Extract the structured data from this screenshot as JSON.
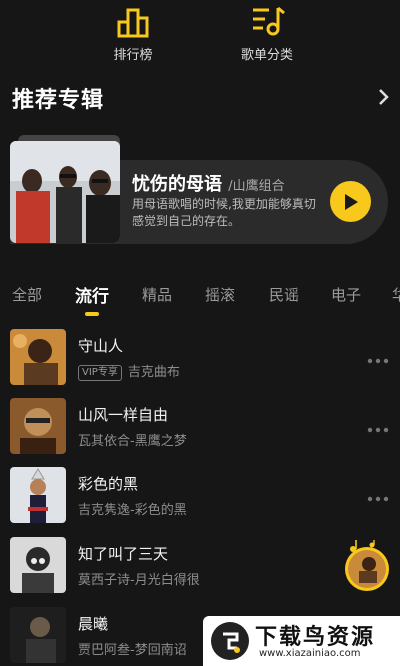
{
  "top_nav": {
    "items": [
      {
        "label": "排行榜",
        "icon": "ranking-icon"
      },
      {
        "label": "歌单分类",
        "icon": "playlist-category-icon"
      }
    ]
  },
  "recommended": {
    "title": "推荐专辑",
    "album": {
      "name": "忧伤的母语",
      "artist": "/山鹰组合",
      "description": "用母语歌唱的时候,我更加能够真切感觉到自己的存在。"
    }
  },
  "tabs": [
    "全部",
    "流行",
    "精品",
    "摇滚",
    "民谣",
    "电子",
    "华"
  ],
  "active_tab": "流行",
  "songs": [
    {
      "title": "守山人",
      "badge": "VIP专享",
      "subtitle": "吉克曲布"
    },
    {
      "title": "山风一样自由",
      "subtitle": "瓦其依合-黑鹰之梦"
    },
    {
      "title": "彩色的黑",
      "subtitle": "吉克隽逸-彩色的黑"
    },
    {
      "title": "知了叫了三天",
      "subtitle": "莫西子诗-月光白得很"
    },
    {
      "title": "晨曦",
      "subtitle": "贾巴阿叁-梦回南诏"
    }
  ],
  "watermark": {
    "text": "下载鸟资源",
    "url": "www.xiazainiao.com"
  },
  "colors": {
    "accent": "#f8c81c",
    "background": "#161616",
    "card": "#2b2b2b"
  }
}
